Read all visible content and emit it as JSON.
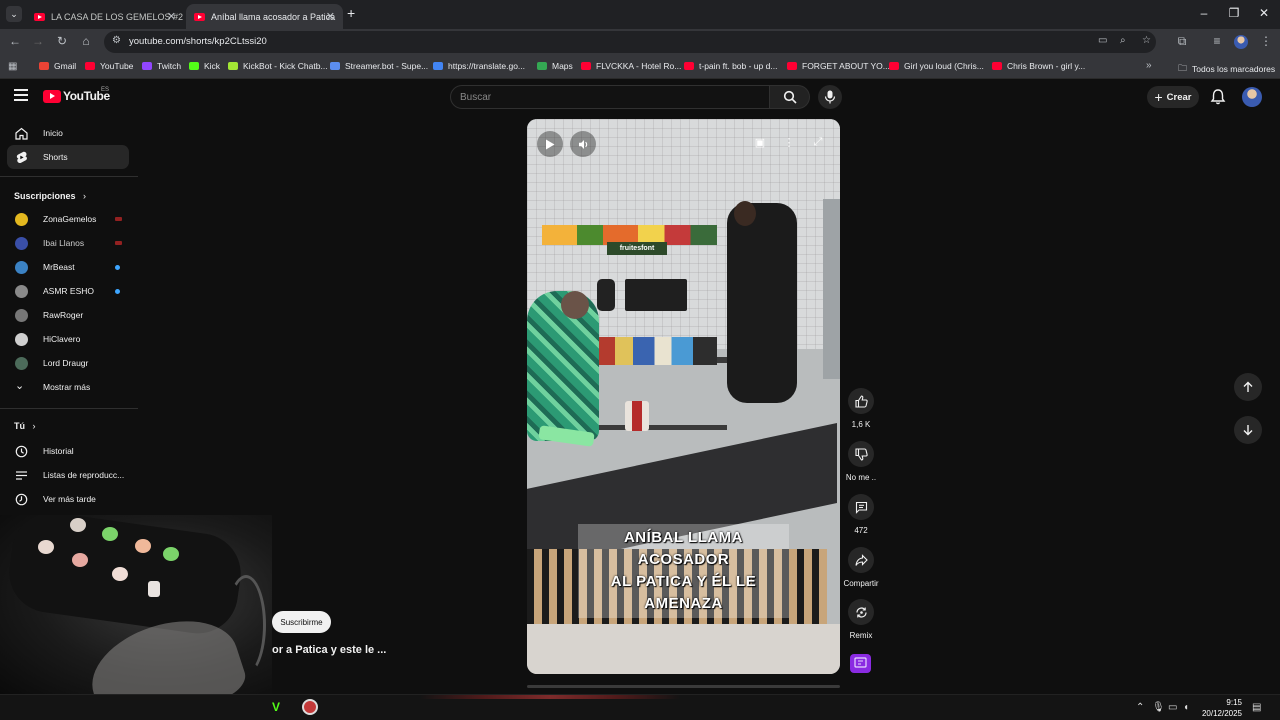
{
  "browser": {
    "tabs": [
      {
        "title": "LA CASA DE LOS GEMELOS #2",
        "active": false
      },
      {
        "title": "Aníbal llama acosador a Patica",
        "active": true
      }
    ],
    "new_tab": "+",
    "url": "youtube.com/shorts/kp2CLtssi20",
    "bookmarks": [
      {
        "label": "Gmail",
        "color": "#ea4335"
      },
      {
        "label": "YouTube",
        "color": "#ff0033"
      },
      {
        "label": "Twitch",
        "color": "#9146ff"
      },
      {
        "label": "Kick",
        "color": "#53fc18"
      },
      {
        "label": "KickBot - Kick Chatb...",
        "color": "#a3e635"
      },
      {
        "label": "Streamer.bot - Supe...",
        "color": "#5b8def"
      },
      {
        "label": "https://translate.go...",
        "color": "#4285f4"
      },
      {
        "label": "Maps",
        "color": "#34a853"
      },
      {
        "label": "FLVCKKA - Hotel Ro...",
        "color": "#ff0033"
      },
      {
        "label": "t-pain ft. bob - up d...",
        "color": "#ff0033"
      },
      {
        "label": "FORGET ABOUT YO...",
        "color": "#ff0033"
      },
      {
        "label": "Girl you loud (Chris...",
        "color": "#ff0033"
      },
      {
        "label": "Chris Brown - girl y...",
        "color": "#ff0033"
      }
    ],
    "all_bookmarks": "Todos los marcadores"
  },
  "header": {
    "logo": "YouTube",
    "logo_country": "ES",
    "search_placeholder": "Buscar",
    "create_label": "Crear"
  },
  "sidebar": {
    "main": [
      {
        "label": "Inicio",
        "icon": "home-icon"
      },
      {
        "label": "Shorts",
        "icon": "shorts-icon"
      }
    ],
    "subscriptions_title": "Suscripciones",
    "subscriptions": [
      {
        "name": "ZonaGemelos",
        "color": "#e3b81f"
      },
      {
        "name": "Ibai Llanos",
        "color": "#3a4fa8"
      },
      {
        "name": "MrBeast",
        "color": "#3b82c4"
      },
      {
        "name": "ASMR ESHO",
        "color": "#8a8a8a"
      },
      {
        "name": "RawRoger",
        "color": "#777777"
      },
      {
        "name": "HiClavero",
        "color": "#cfcfcf"
      },
      {
        "name": "Lord Draugr",
        "color": "#4c6b5a"
      }
    ],
    "show_more": "Mostrar más",
    "you_title": "Tú",
    "you_items": [
      {
        "label": "Historial",
        "icon": "history-icon"
      },
      {
        "label": "Listas de reproducc...",
        "icon": "playlists-icon"
      },
      {
        "label": "Ver más tarde",
        "icon": "watch-later-icon"
      }
    ]
  },
  "short": {
    "caption_line1": "ANÍBAL LLAMA ACOSADOR",
    "caption_line2": "AL PATICA Y ÉL LE AMENAZA",
    "store_sign": "fruitesfont",
    "subscribe_label": "Suscribirme",
    "title_fragment": "or a Patica y este le ..."
  },
  "actions": {
    "likes": "1,6 K",
    "dislike_label": "No me ..",
    "comments": "472",
    "share_label": "Compartir",
    "remix_label": "Remix"
  },
  "taskbar": {
    "time": "9:15",
    "date": "20/12/2025"
  }
}
